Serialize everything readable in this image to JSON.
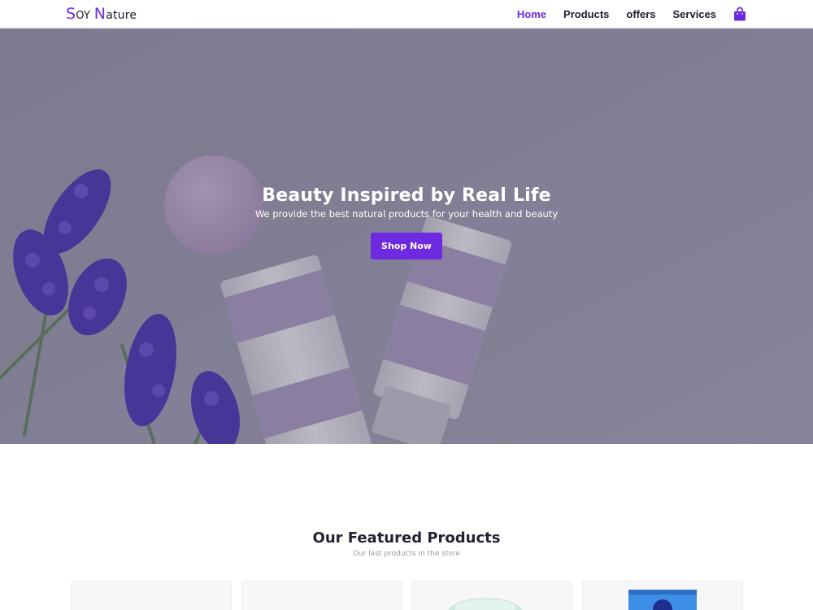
{
  "brand": {
    "logo_s": "S",
    "logo_oy": "OY",
    "logo_n": "N",
    "logo_ature": "ature",
    "accent_color": "#6d2ae0"
  },
  "nav": {
    "items": [
      {
        "label": "Home",
        "active": true
      },
      {
        "label": "Products",
        "active": false
      },
      {
        "label": "offers",
        "active": false
      },
      {
        "label": "Services",
        "active": false
      }
    ],
    "cart_icon": "shopping-bag-icon"
  },
  "hero": {
    "title": "Beauty Inspired by Real Life",
    "subtitle": "We provide the best natural products for your health and beauty",
    "cta_label": "Shop Now"
  },
  "featured": {
    "title": "Our Featured Products",
    "subtitle": "Our last products in the store",
    "cards_visible": 4
  }
}
